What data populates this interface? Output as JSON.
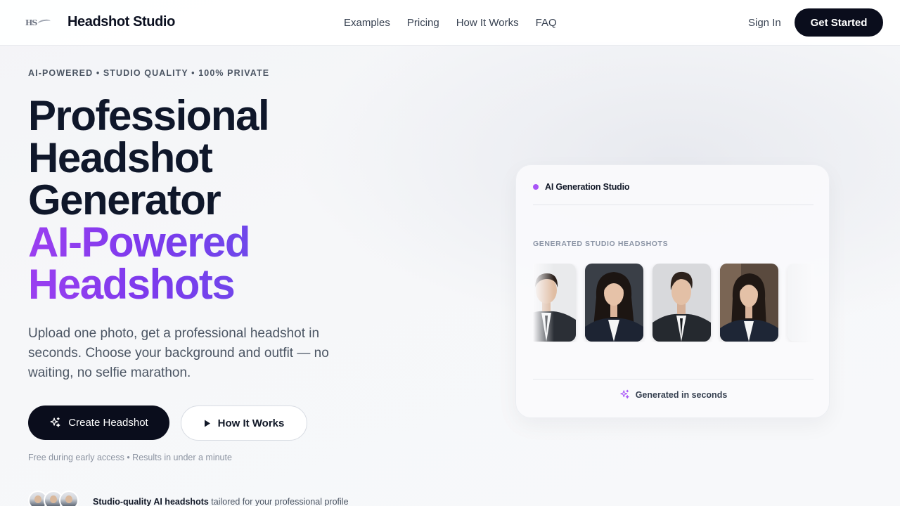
{
  "nav": {
    "brand": "Headshot Studio",
    "logo_text": "HS",
    "links": [
      "Examples",
      "Pricing",
      "How It Works",
      "FAQ"
    ],
    "sign_in": "Sign In",
    "cta": "Get Started"
  },
  "hero": {
    "eyebrow": "AI-POWERED • STUDIO QUALITY • 100% PRIVATE",
    "headline_lines": [
      "Professional",
      "Headshot",
      "Generator"
    ],
    "headline_accent_lines": [
      "AI-Powered",
      "Headshots"
    ],
    "subtext": "Upload one photo, get a professional headshot in seconds. Choose your background and outfit — no waiting, no selfie marathon.",
    "primary_button": "Create Headshot",
    "secondary_button": "How It Works",
    "fineprint": "Free during early access • Results in under a minute",
    "proof_bold": "Studio-quality AI headshots",
    "proof_rest": " tailored for your professional profile"
  },
  "studio_card": {
    "title": "AI Generation Studio",
    "section_label": "GENERATED STUDIO HEADSHOTS",
    "footer": "Generated in seconds",
    "thumbnails": [
      "man-suit-headshot",
      "woman-blazer-headshot",
      "man-suit-headshot",
      "woman-blazer-headshot",
      "placeholder"
    ]
  },
  "colors": {
    "dark_button": "#0a0d1c",
    "accent_purple": "#9b3ff0",
    "accent_violet": "#6d4aea",
    "status_dot": "#a855f7"
  }
}
